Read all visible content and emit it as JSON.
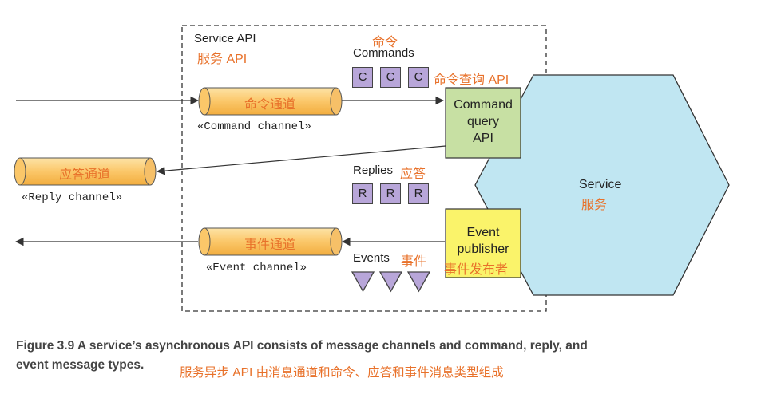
{
  "service_api": {
    "title": "Service API",
    "title_cn": "服务 API"
  },
  "commands": {
    "label_cn": "命令",
    "label": "Commands",
    "items": [
      "C",
      "C",
      "C"
    ],
    "api_cn": "命令查询 API"
  },
  "command_channel": {
    "label_cn": "命令通道",
    "stereotype": "«Command channel»"
  },
  "reply_channel": {
    "label_cn": "应答通道",
    "stereotype": "«Reply channel»"
  },
  "event_channel": {
    "label_cn": "事件通道",
    "stereotype": "«Event channel»"
  },
  "command_query_api": {
    "line1": "Command",
    "line2": "query",
    "line3": "API"
  },
  "replies": {
    "label": "Replies",
    "label_cn": "应答",
    "items": [
      "R",
      "R",
      "R"
    ]
  },
  "event_publisher": {
    "line1": "Event",
    "line2": "publisher",
    "label_cn": "事件发布者"
  },
  "events": {
    "label": "Events",
    "label_cn": "事件"
  },
  "service": {
    "label": "Service",
    "label_cn": "服务"
  },
  "caption": {
    "line1": "Figure 3.9   A service’s asynchronous API consists of message channels and command, reply, and",
    "line2": "event message types.",
    "line2_cn": "服务异步 API 由消息通道和命令、应答和事件消息类型组成"
  },
  "colors": {
    "channel": "#fbc769",
    "command_box": "#c7e0a3",
    "publisher_box": "#faf36a",
    "service": "#c0e6f2",
    "message": "#b8a6d9",
    "chinese_text": "#e8712a"
  }
}
